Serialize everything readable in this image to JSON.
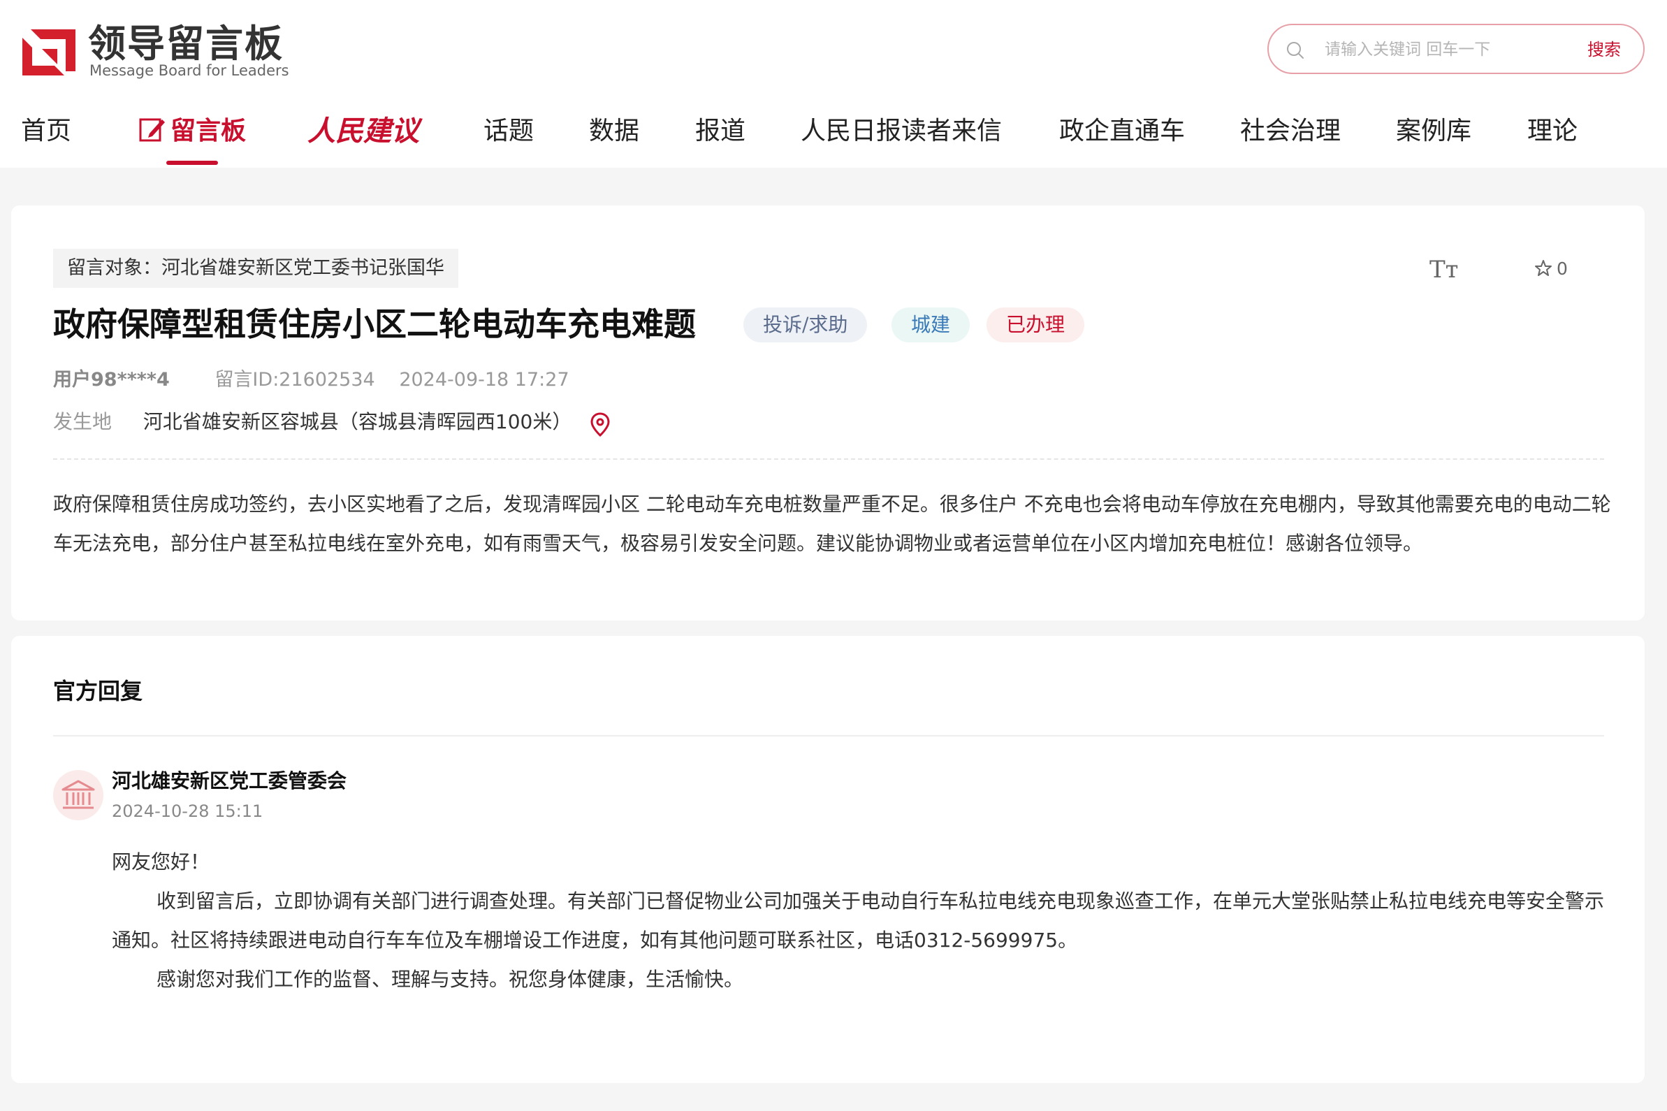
{
  "logo": {
    "title": "领导留言板",
    "subtitle": "Message Board for Leaders"
  },
  "search": {
    "placeholder": "请输入关键词 回车一下",
    "button_label": "搜索"
  },
  "nav": {
    "items": [
      {
        "label": "首页"
      },
      {
        "label": "留言板"
      },
      {
        "label": "人民建议"
      },
      {
        "label": "话题"
      },
      {
        "label": "数据"
      },
      {
        "label": "报道"
      },
      {
        "label": "人民日报读者来信"
      },
      {
        "label": "政企直通车"
      },
      {
        "label": "社会治理"
      },
      {
        "label": "案例库"
      },
      {
        "label": "理论"
      }
    ],
    "active_index": 1
  },
  "message": {
    "target": "留言对象：河北省雄安新区党工委书记张国华",
    "font_size_icon": "Tт",
    "favorite_count": "0",
    "title": "政府保障型租赁住房小区二轮电动车充电难题",
    "badges": {
      "type": "投诉/求助",
      "category": "城建",
      "status": "已办理"
    },
    "user": "用户98****4",
    "message_id": "留言ID:21602534",
    "datetime": "2024-09-18 17:27",
    "location_label": "发生地",
    "location": "河北省雄安新区容城县（容城县清晖园西100米）",
    "content": "政府保障租赁住房成功签约，去小区实地看了之后，发现清晖园小区 二轮电动车充电桩数量严重不足。很多住户 不充电也会将电动车停放在充电棚内，导致其他需要充电的电动二轮车无法充电，部分住户甚至私拉电线在室外充电，如有雨雪天气，极容易引发安全问题。建议能协调物业或者运营单位在小区内增加充电桩位！感谢各位领导。"
  },
  "reply": {
    "heading": "官方回复",
    "organization": "河北雄安新区党工委管委会",
    "datetime": "2024-10-28 15:11",
    "greeting": "网友您好！",
    "paragraph1": "收到留言后，立即协调有关部门进行调查处理。有关部门已督促物业公司加强关于电动自行车私拉电线充电现象巡查工作，在单元大堂张贴禁止私拉电线充电等安全警示通知。社区将持续跟进电动自行车车位及车棚增设工作进度，如有其他问题可联系社区，电话0312-5699975。",
    "paragraph2": "感谢您对我们工作的监督、理解与支持。祝您身体健康，生活愉快。"
  },
  "colors": {
    "brand_red": "#c8102e",
    "badge_type_bg": "#eef1f6",
    "badge_category_bg": "#ebf7f4",
    "badge_status_bg": "#fdeeee"
  },
  "icons": {
    "logo": "logo-mark-icon",
    "search": "search-icon",
    "message_board": "pen-square-icon",
    "font_size": "font-size-icon",
    "favorite": "star-icon",
    "location": "map-pin-icon",
    "organization": "government-building-icon"
  }
}
